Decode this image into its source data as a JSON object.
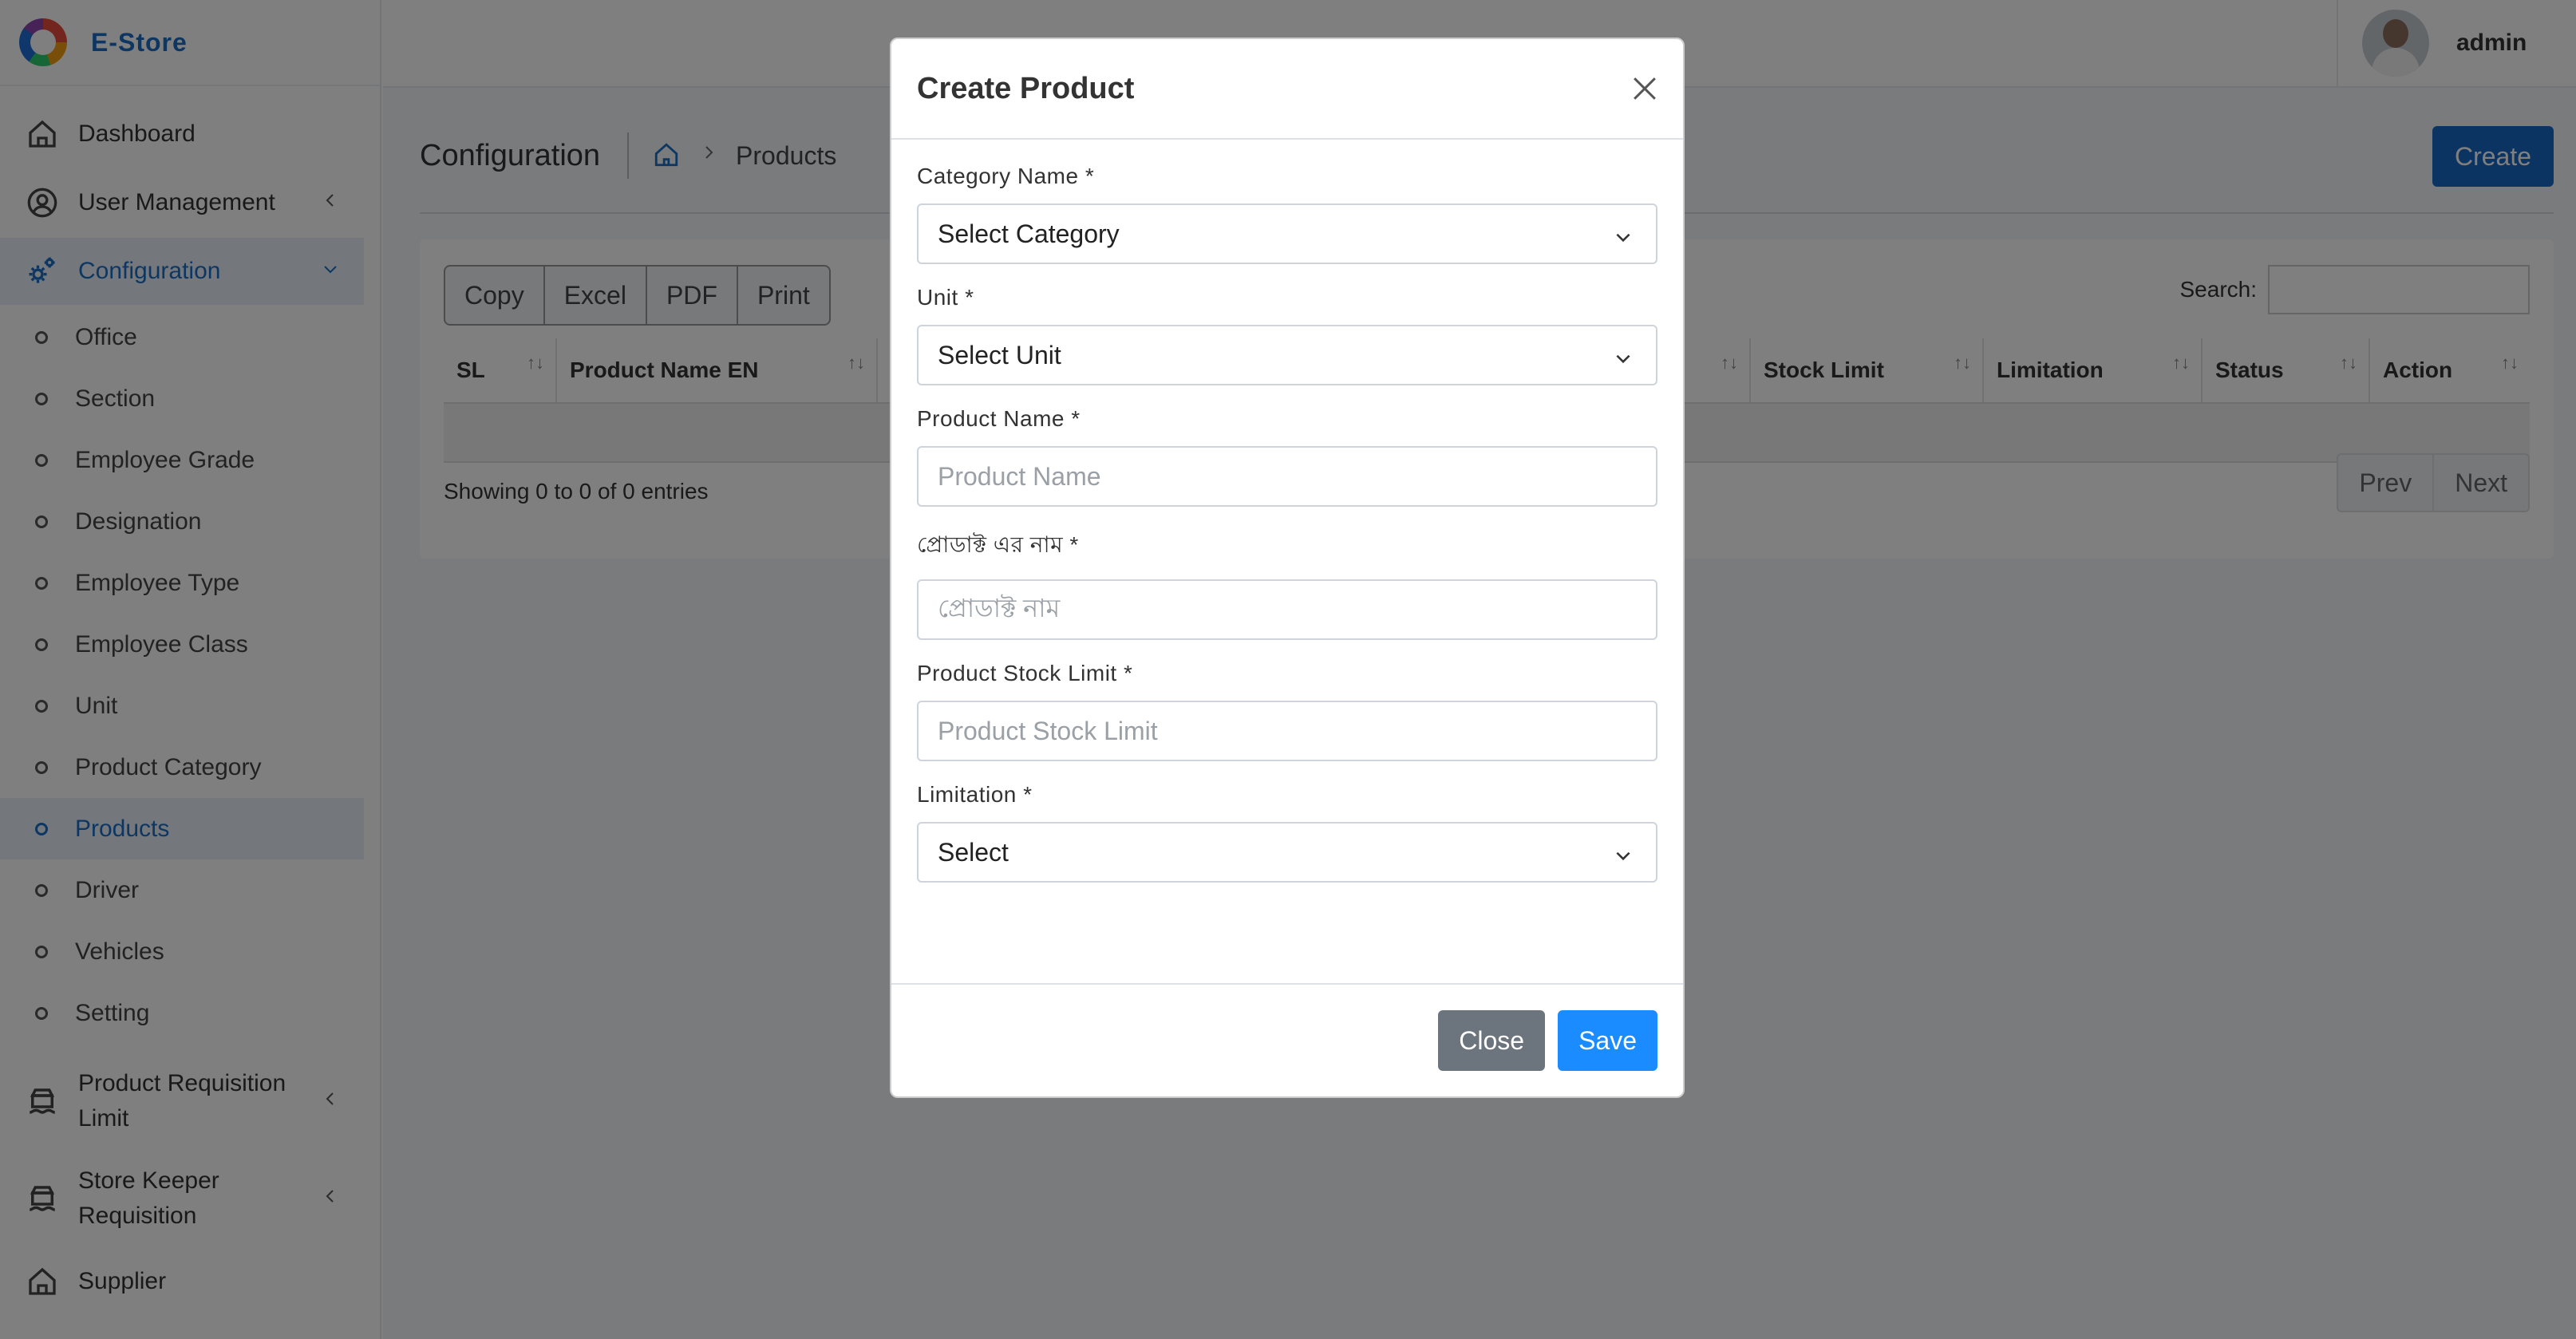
{
  "brand": {
    "name": "E-Store"
  },
  "user": {
    "name": "admin"
  },
  "sidebar": {
    "items": [
      {
        "label": "Dashboard",
        "icon": "home-icon"
      },
      {
        "label": "User Management",
        "icon": "user-circle-icon"
      },
      {
        "label": "Configuration",
        "icon": "gears-icon"
      },
      {
        "label": "Product Requisition Limit",
        "icon": "box-icon"
      },
      {
        "label": "Store Keeper Requisition",
        "icon": "box-icon"
      },
      {
        "label": "Supplier",
        "icon": "home-icon"
      }
    ],
    "config_sub": [
      "Office",
      "Section",
      "Employee Grade",
      "Designation",
      "Employee Type",
      "Employee Class",
      "Unit",
      "Product Category",
      "Products",
      "Driver",
      "Vehicles",
      "Setting"
    ]
  },
  "page": {
    "title": "Configuration",
    "breadcrumb_current": "Products",
    "create_label": "Create"
  },
  "toolbar": {
    "copy": "Copy",
    "excel": "Excel",
    "pdf": "PDF",
    "print": "Print"
  },
  "search": {
    "label": "Search:"
  },
  "table": {
    "columns": [
      "SL",
      "Product Name EN",
      "",
      "Stock Limit",
      "Limitation",
      "Status",
      "Action"
    ],
    "info": "Showing 0 to 0 of 0 entries",
    "prev": "Prev",
    "next": "Next"
  },
  "modal": {
    "title": "Create Product",
    "fields": [
      {
        "label": "Category Name *",
        "value": "Select Category",
        "type": "select"
      },
      {
        "label": "Unit *",
        "value": "Select Unit",
        "type": "select"
      },
      {
        "label": "Product Name *",
        "placeholder": "Product Name",
        "type": "input"
      },
      {
        "label": "প্রোডাক্ট এর নাম *",
        "placeholder": "প্রোডাক্ট নাম",
        "type": "input"
      },
      {
        "label": "Product Stock Limit *",
        "placeholder": "Product Stock Limit",
        "type": "input"
      },
      {
        "label": "Limitation *",
        "value": "Select",
        "type": "select"
      }
    ],
    "close_label": "Close",
    "save_label": "Save"
  },
  "colors": {
    "primary": "#1769c4",
    "save": "#1a8cff",
    "close": "#6c757d",
    "active_bg": "#e8f0fa"
  }
}
